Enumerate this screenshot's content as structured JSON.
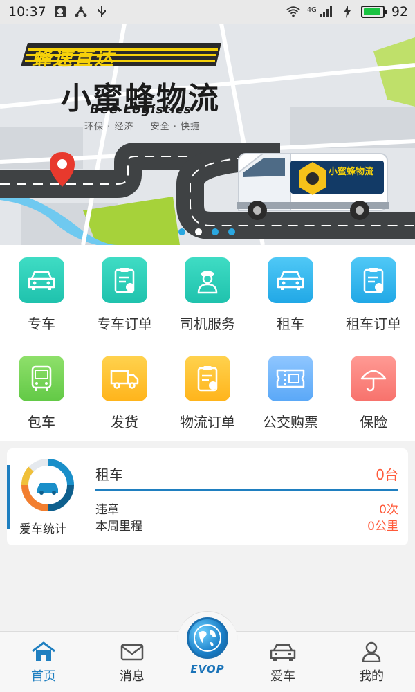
{
  "status_bar": {
    "time": "10:37",
    "network": "4G",
    "battery": "92",
    "battery_level": 0.92
  },
  "banner": {
    "slogan": "蜂速直达",
    "brand_cn": "小蜜蜂物流",
    "brand_en": "Bee Logistics",
    "tagline": "环保 · 经济 — 安全 · 快捷",
    "van_text": "小蜜蜂物流",
    "dots_count": 4,
    "active_dot": 1
  },
  "services": [
    {
      "label": "专车",
      "icon": "car-icon",
      "color": "teal"
    },
    {
      "label": "专车订单",
      "icon": "order-special-icon",
      "color": "teal"
    },
    {
      "label": "司机服务",
      "icon": "driver-icon",
      "color": "teal"
    },
    {
      "label": "租车",
      "icon": "rental-car-icon",
      "color": "blue"
    },
    {
      "label": "租车订单",
      "icon": "rental-order-icon",
      "color": "blue"
    },
    {
      "label": "包车",
      "icon": "bus-icon",
      "color": "green"
    },
    {
      "label": "发货",
      "icon": "truck-icon",
      "color": "orange"
    },
    {
      "label": "物流订单",
      "icon": "logistics-order-icon",
      "color": "orange"
    },
    {
      "label": "公交购票",
      "icon": "ticket-icon",
      "color": "lightblue"
    },
    {
      "label": "保险",
      "icon": "umbrella-icon",
      "color": "salmon"
    }
  ],
  "stats": {
    "caption": "爱车统计",
    "main_label": "租车",
    "main_value": "0台",
    "rows": [
      {
        "label": "违章",
        "value": "0次"
      },
      {
        "label": "本周里程",
        "value": "0公里"
      }
    ]
  },
  "nav": {
    "home": "首页",
    "messages": "消息",
    "center": "EVOP",
    "car": "爱车",
    "mine": "我的"
  }
}
